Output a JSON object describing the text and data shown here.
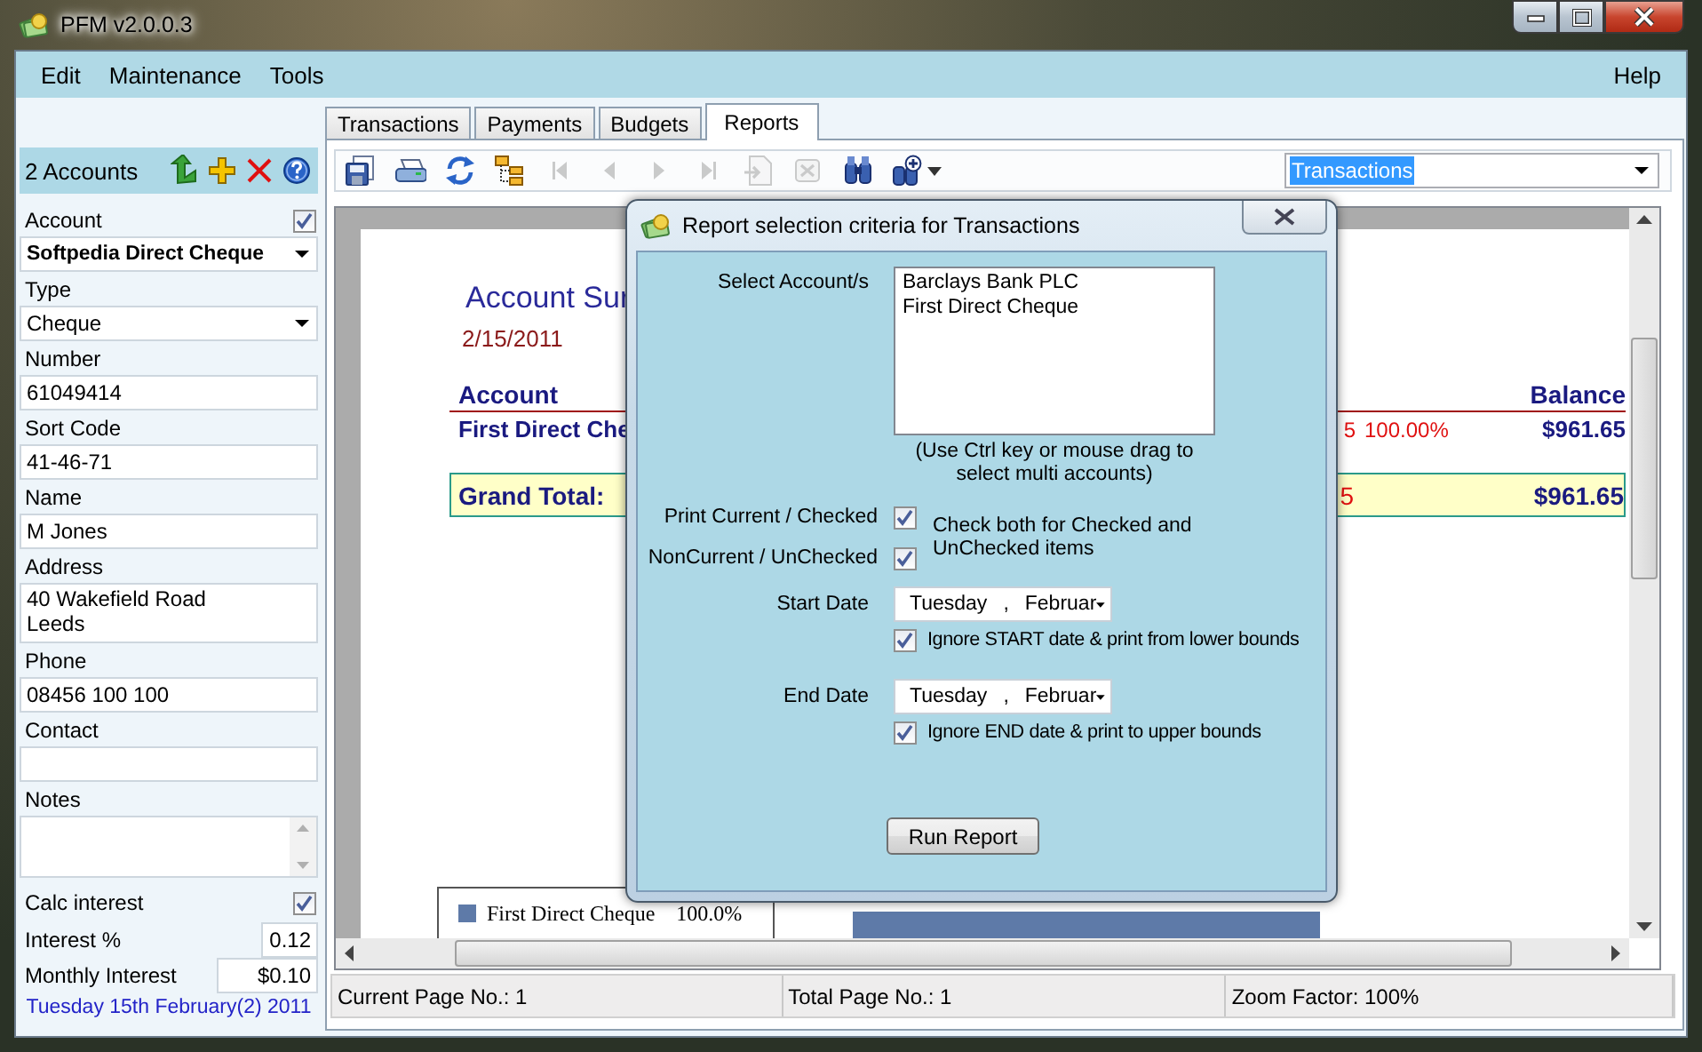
{
  "window": {
    "title": "PFM v2.0.0.3"
  },
  "menu": [
    {
      "label": "Edit"
    },
    {
      "label": "Maintenance"
    },
    {
      "label": "Tools"
    }
  ],
  "help_menu": {
    "label": "Help"
  },
  "accounts_panel": {
    "title": "2 Accounts",
    "account": {
      "label": "Account",
      "checked": true,
      "value": "Softpedia Direct Cheque"
    },
    "fields": [
      {
        "kind": "select",
        "label": "Type",
        "value": "Cheque"
      },
      {
        "kind": "text",
        "label": "Number",
        "value": "61049414"
      },
      {
        "kind": "text",
        "label": "Sort Code",
        "value": "41-46-71"
      },
      {
        "kind": "text",
        "label": "Name",
        "value": "M Jones"
      },
      {
        "kind": "multiline",
        "label": "Address",
        "value": "40 Wakefield Road\nLeeds"
      },
      {
        "kind": "text",
        "label": "Phone",
        "value": "08456 100 100"
      },
      {
        "kind": "text",
        "label": "Contact"
      },
      {
        "kind": "notes",
        "label": "Notes"
      }
    ],
    "calc_interest": {
      "label": "Calc interest",
      "checked": true
    },
    "interest": {
      "label": "Interest %",
      "value": "0.12"
    },
    "monthly_interest": {
      "label": "Monthly Interest",
      "value": "$0.10"
    },
    "date": "Tuesday 15th February(2) 2011"
  },
  "tabs": [
    {
      "label": "Transactions",
      "selected": false
    },
    {
      "label": "Payments",
      "selected": false
    },
    {
      "label": "Budgets",
      "selected": false
    },
    {
      "label": "Reports",
      "selected": true
    }
  ],
  "toolbar": [
    {
      "kind": "save",
      "disabled": false
    },
    {
      "kind": "print",
      "disabled": false
    },
    {
      "kind": "refresh",
      "disabled": false
    },
    {
      "kind": "tree",
      "disabled": false
    },
    {
      "kind": "first",
      "disabled": true
    },
    {
      "kind": "prev",
      "disabled": true
    },
    {
      "kind": "next",
      "disabled": true
    },
    {
      "kind": "last",
      "disabled": true
    },
    {
      "kind": "export",
      "disabled": true
    },
    {
      "kind": "stop",
      "disabled": true
    },
    {
      "kind": "find",
      "disabled": false
    },
    {
      "kind": "zoom",
      "disabled": false
    }
  ],
  "report_picker": {
    "value": "Transactions"
  },
  "report": {
    "title": "Account Sur",
    "date": "2/15/2011",
    "columns": {
      "account": "Account",
      "balance": "Balance"
    },
    "row": {
      "account": "First Direct Che",
      "amount": "5",
      "percent": "100.00%",
      "balance": "$961.65"
    },
    "total": {
      "label": "Grand Total:",
      "amount": "5",
      "balance": "$961.65"
    },
    "legend": [
      {
        "label": "First Direct Cheque",
        "value": "100.0%"
      }
    ]
  },
  "status_bar": [
    "Current Page No.: 1",
    "Total Page No.: 1",
    "Zoom Factor: 100%"
  ],
  "dialog": {
    "title": "Report selection criteria for Transactions",
    "accounts_label": "Select Account/s",
    "accounts": [
      "Barclays Bank PLC",
      "First Direct Cheque"
    ],
    "hint": "(Use Ctrl key or mouse drag  to select multi accounts)",
    "print_current": {
      "label": "Print Current / Checked",
      "checked": true
    },
    "non_current": {
      "label": "NonCurrent / UnChecked",
      "checked": true
    },
    "check_note": "Check both for Checked and UnChecked items",
    "start_date": {
      "label": "Start Date",
      "day": "Tuesday",
      "separator": ",",
      "month": "Februar",
      "ignore": {
        "label": "Ignore START date & print from lower bounds",
        "checked": true
      }
    },
    "end_date": {
      "label": "End Date",
      "day": "Tuesday",
      "separator": ",",
      "month": "Februar",
      "ignore": {
        "label": "Ignore END date & print to upper bounds",
        "checked": true
      }
    },
    "run_button": "Run Report"
  }
}
